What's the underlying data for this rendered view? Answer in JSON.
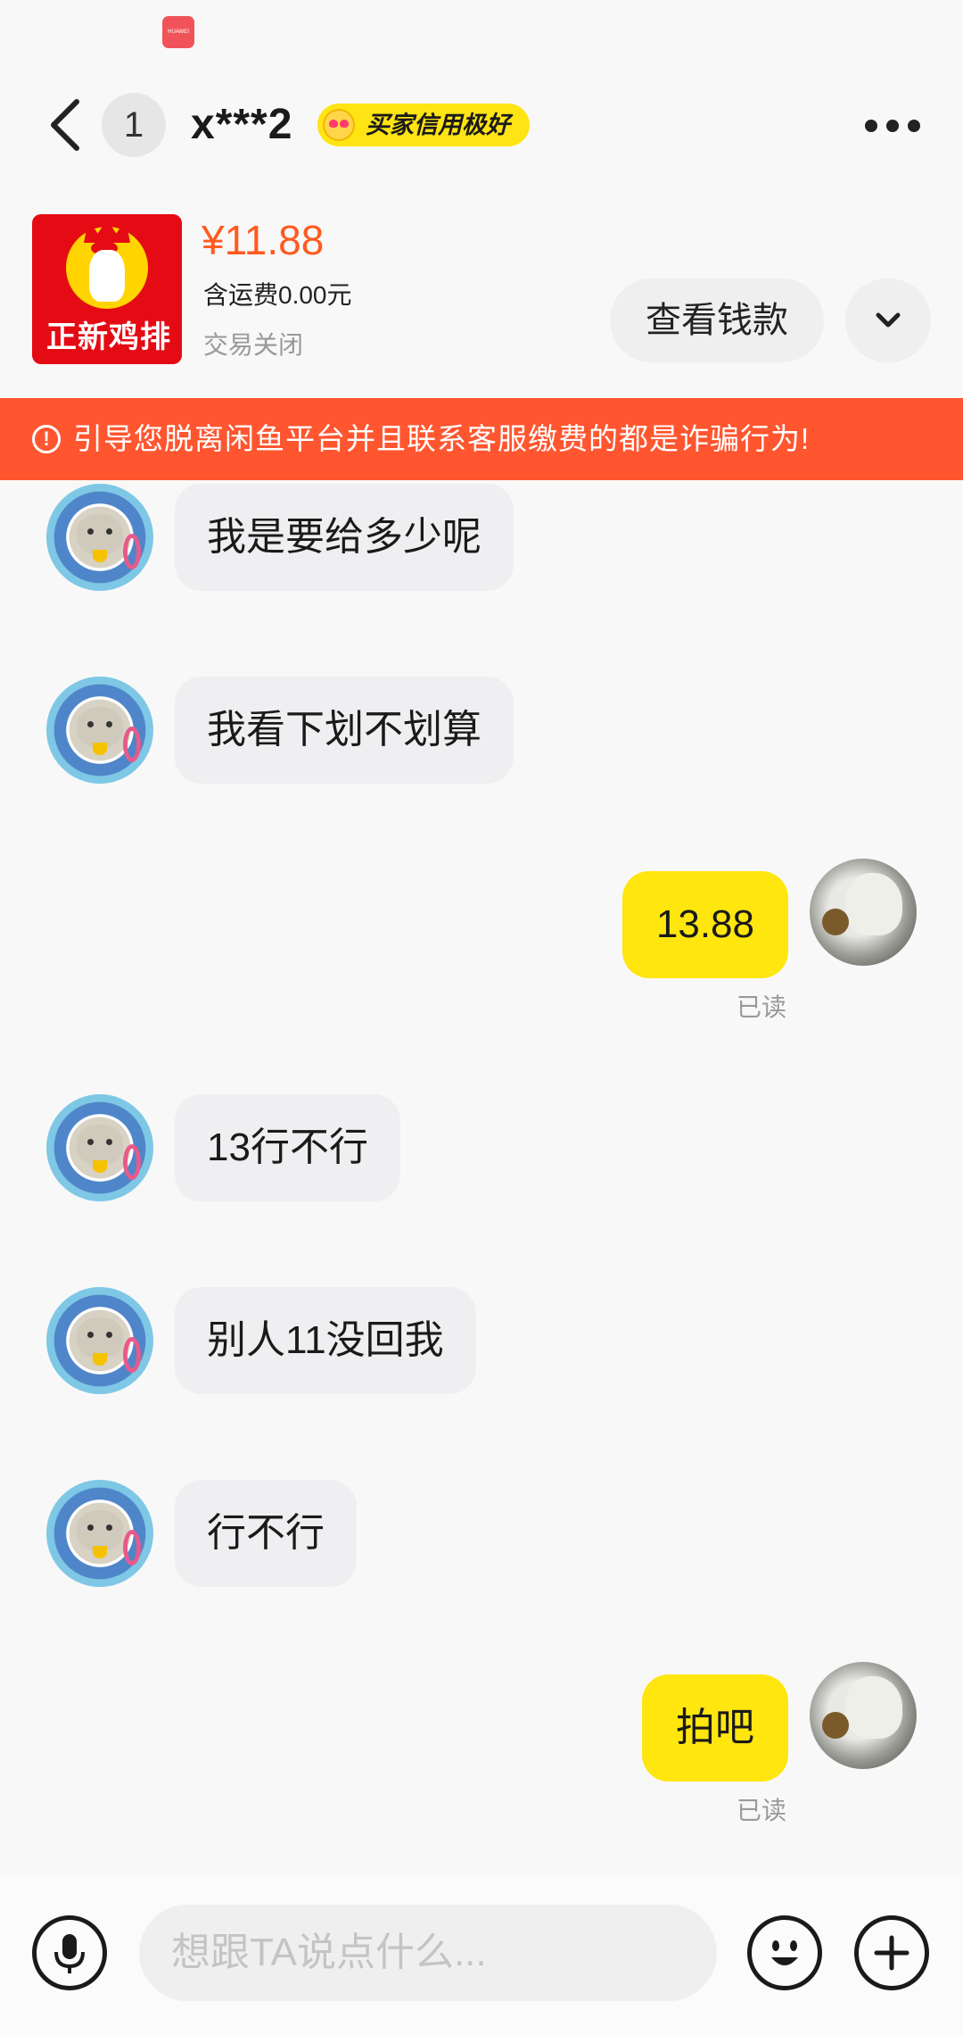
{
  "status_bar": {
    "logo_text": "HUAWEI"
  },
  "header": {
    "unread_count": "1",
    "contact_name": "x***2",
    "credit_badge": "买家信用极好"
  },
  "product": {
    "thumb_text": "正新鸡排",
    "price": "¥11.88",
    "shipping": "含运费0.00元",
    "status": "交易关闭",
    "view_payment_label": "查看钱款"
  },
  "warning": {
    "icon": "!",
    "text": "引导您脱离闲鱼平台并且联系客服缴费的都是诈骗行为!"
  },
  "messages": [
    {
      "side": "left",
      "text": "我是要给多少呢"
    },
    {
      "side": "left",
      "text": "我看下划不划算"
    },
    {
      "side": "right",
      "text": "13.88",
      "receipt": "已读"
    },
    {
      "side": "left",
      "text": "13行不行"
    },
    {
      "side": "left",
      "text": "别人11没回我"
    },
    {
      "side": "left",
      "text": "行不行"
    },
    {
      "side": "right",
      "text": "拍吧",
      "receipt": "已读"
    }
  ],
  "input": {
    "placeholder": "想跟TA说点什么..."
  },
  "colors": {
    "accent_yellow": "#ffe60f",
    "price_orange": "#ff5a1f",
    "warning_red": "#ff5630"
  }
}
